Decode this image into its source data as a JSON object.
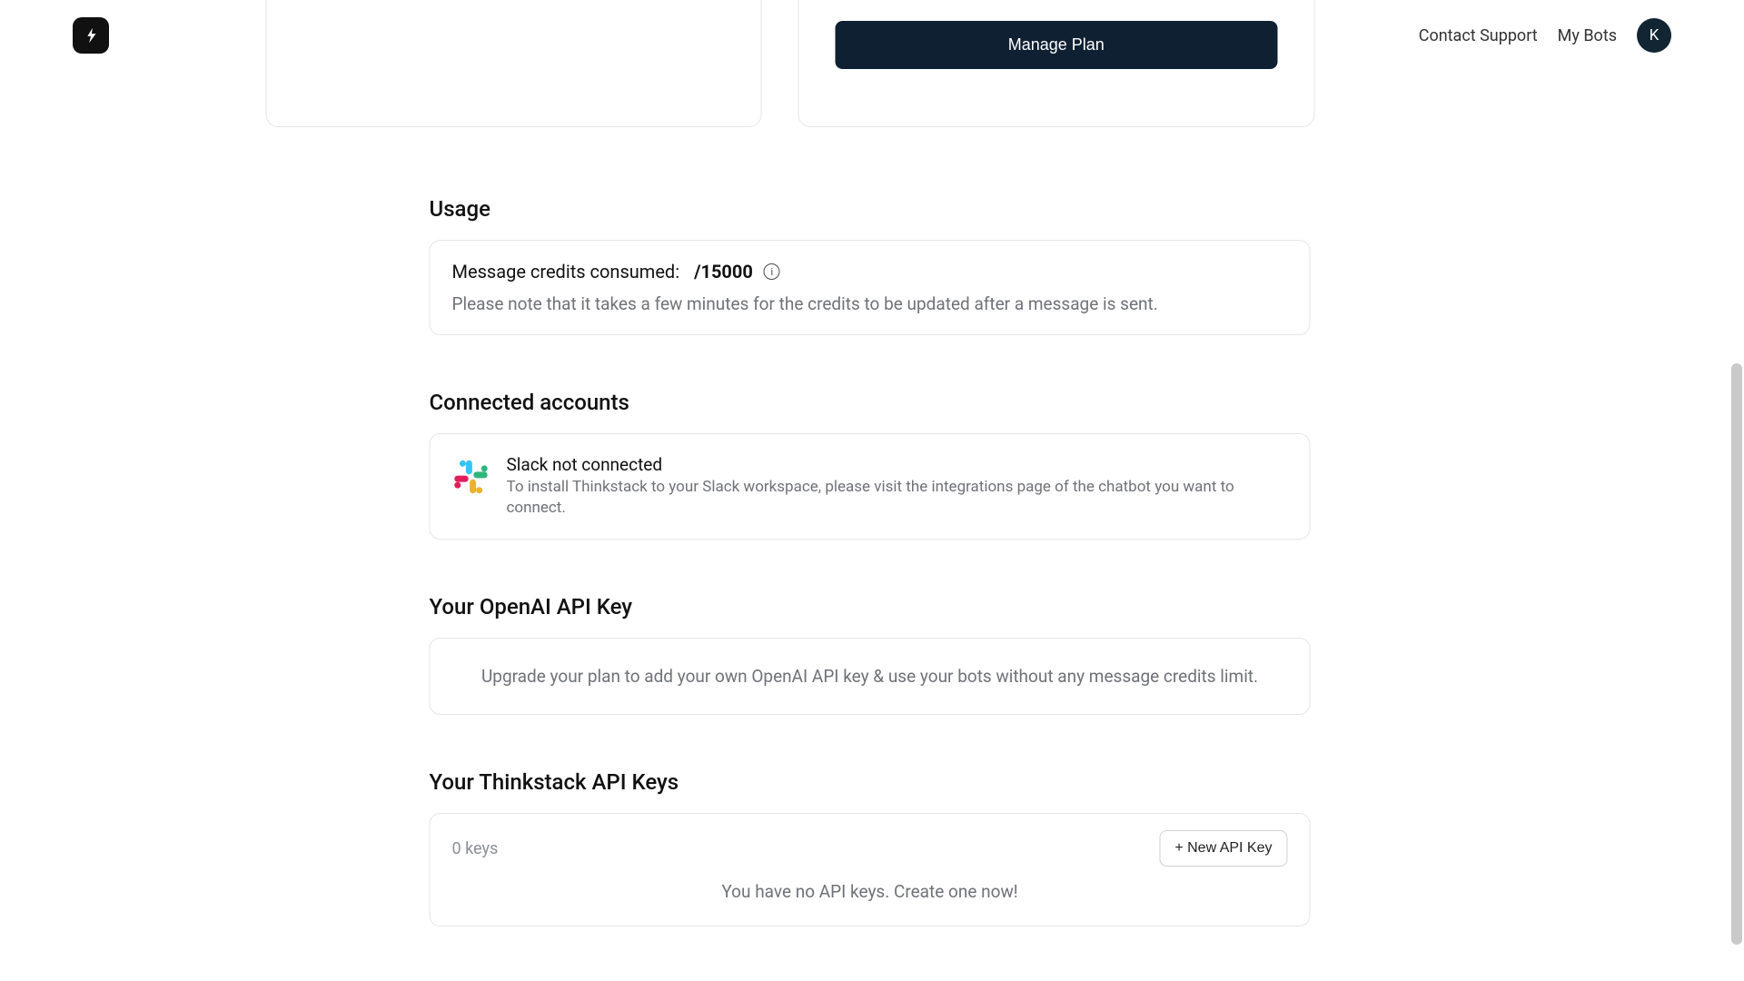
{
  "header": {
    "contact_support": "Contact Support",
    "my_bots": "My Bots",
    "avatar_initial": "K"
  },
  "plan_card": {
    "manage_plan_label": "Manage Plan"
  },
  "usage": {
    "title": "Usage",
    "label": "Message credits consumed:",
    "consumed": "",
    "limit_display": "/15000",
    "limit": 15000,
    "note": "Please note that it takes a few minutes for the credits to be updated after a message is sent."
  },
  "connected_accounts": {
    "title": "Connected accounts",
    "slack_title": "Slack not connected",
    "slack_description": "To install Thinkstack to your Slack workspace, please visit the integrations page of the chatbot you want to connect."
  },
  "openai": {
    "title": "Your OpenAI API Key",
    "message": "Upgrade your plan to add your own OpenAI API key & use your bots without any message credits limit."
  },
  "thinkstack_keys": {
    "title": "Your Thinkstack API Keys",
    "count_label": "0 keys",
    "count": 0,
    "new_key_label": "+ New API Key",
    "empty_message": "You have no API keys. Create one now!"
  }
}
